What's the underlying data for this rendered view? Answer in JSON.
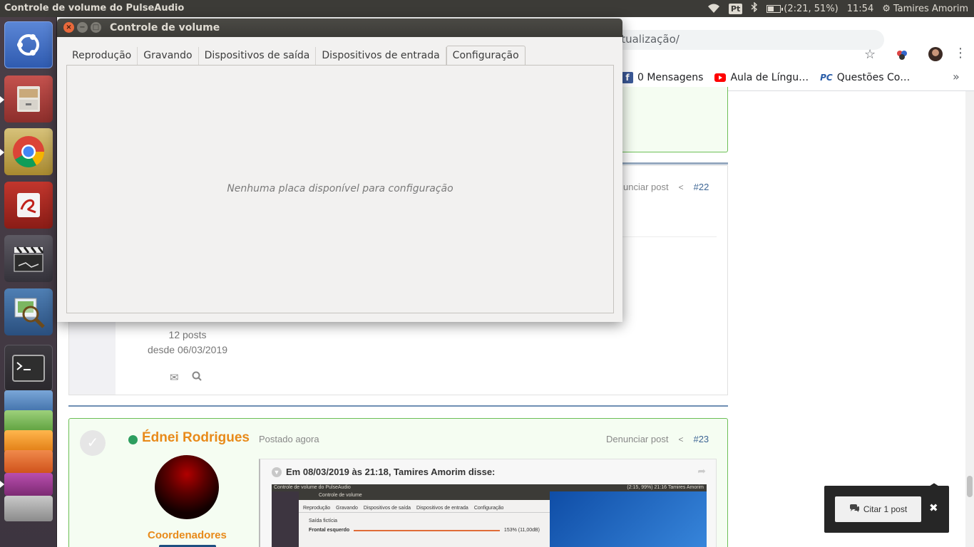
{
  "top_panel": {
    "app_title": "Controle de volume do PulseAudio",
    "keyboard_layout": "Pt",
    "battery_text": "(2:21, 51%)",
    "battery_level": 0.51,
    "clock": "11:54",
    "user_name": "Tamires Amorim"
  },
  "launcher": {
    "items": [
      "ubuntu-dash",
      "files",
      "chrome",
      "text-editor",
      "video-editor",
      "image-viewer",
      "terminal",
      "workspace-stack"
    ]
  },
  "browser": {
    "address_text": "atualização/",
    "bookmarks": [
      {
        "label": "0 Mensagens",
        "icon": "facebook-icon"
      },
      {
        "label": "Aula de Língu…",
        "icon": "youtube-icon"
      },
      {
        "label": "Questões Co…",
        "icon": "pc-icon"
      }
    ],
    "more_bookmarks": "»"
  },
  "forum": {
    "post22": {
      "report_label": "unciar post",
      "number": "#22",
      "author_posts": "12 posts",
      "author_since": "desde 06/03/2019"
    },
    "post23": {
      "author": "Édnei Rodrigues",
      "posted": "Postado agora",
      "report_label": "Denunciar post",
      "number": "#23",
      "group": "Coordenadores",
      "quote_header": "Em 08/03/2019 às 21:18, Tamires Amorim disse:",
      "quote_shot": {
        "top_title": "Controle de volume do PulseAudio",
        "top_right": "(2:15, 99%)  21:16  Tamires Amorim",
        "window_title": "Controle de volume",
        "tabs": [
          "Reprodução",
          "Gravando",
          "Dispositivos de saída",
          "Dispositivos de entrada",
          "Configuração"
        ],
        "row1": "Saída fictícia",
        "row2": "Frontal esquerdo",
        "row2_value": "153% (11,00dB)"
      }
    }
  },
  "quote_popup": {
    "button_label": "Citar 1 post",
    "close": "✖"
  },
  "dialog": {
    "title": "Controle de volume",
    "tabs": [
      "Reprodução",
      "Gravando",
      "Dispositivos de saída",
      "Dispositivos de entrada",
      "Configuração"
    ],
    "active_tab": 4,
    "empty_message": "Nenhuma placa disponível para configuração"
  },
  "colors": {
    "panel": "#3c3b37",
    "author_orange": "#e88a1a",
    "online_green": "#2d9e5f",
    "close_orange": "#e9693b"
  }
}
